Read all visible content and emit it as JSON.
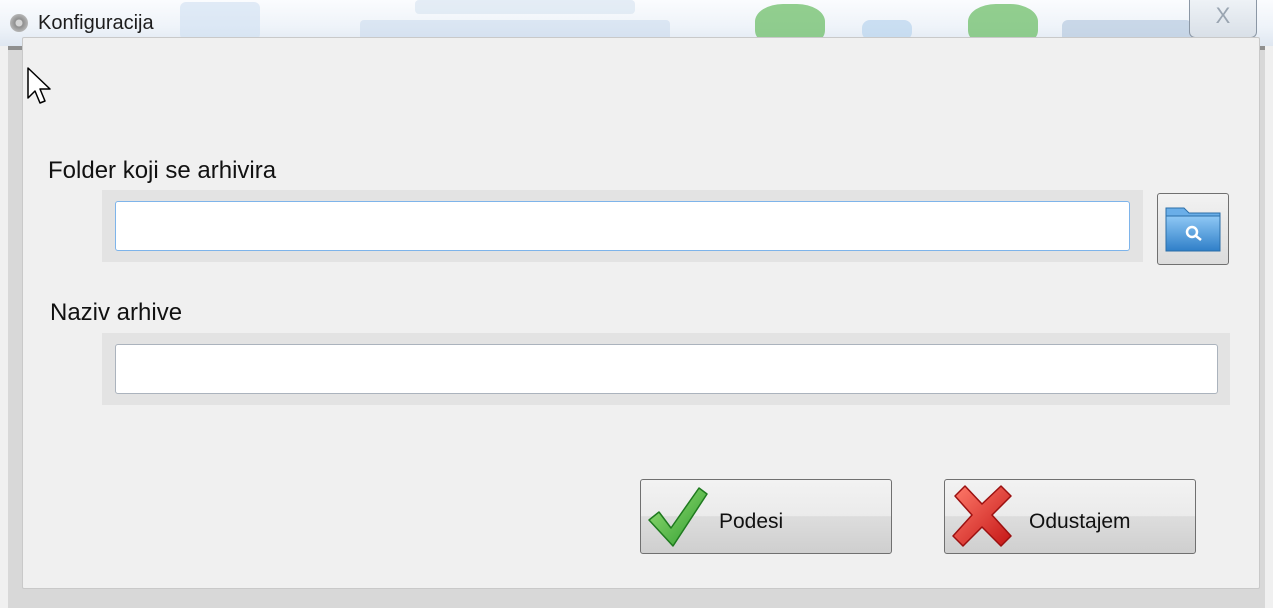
{
  "window": {
    "title": "Konfiguracija",
    "close_glyph": "X",
    "icon": "gear-icon"
  },
  "form": {
    "folder_label": "Folder koji se arhivira",
    "folder_value": "",
    "browse_icon": "folder-search-icon",
    "archive_label": "Naziv arhive",
    "archive_value": ""
  },
  "buttons": {
    "ok_label": "Podesi",
    "ok_icon": "checkmark-icon",
    "cancel_label": "Odustajem",
    "cancel_icon": "red-x-icon"
  },
  "colors": {
    "check_green": "#3aa83a",
    "cross_red": "#d42a2a",
    "folder_blue": "#3d8fd6"
  }
}
